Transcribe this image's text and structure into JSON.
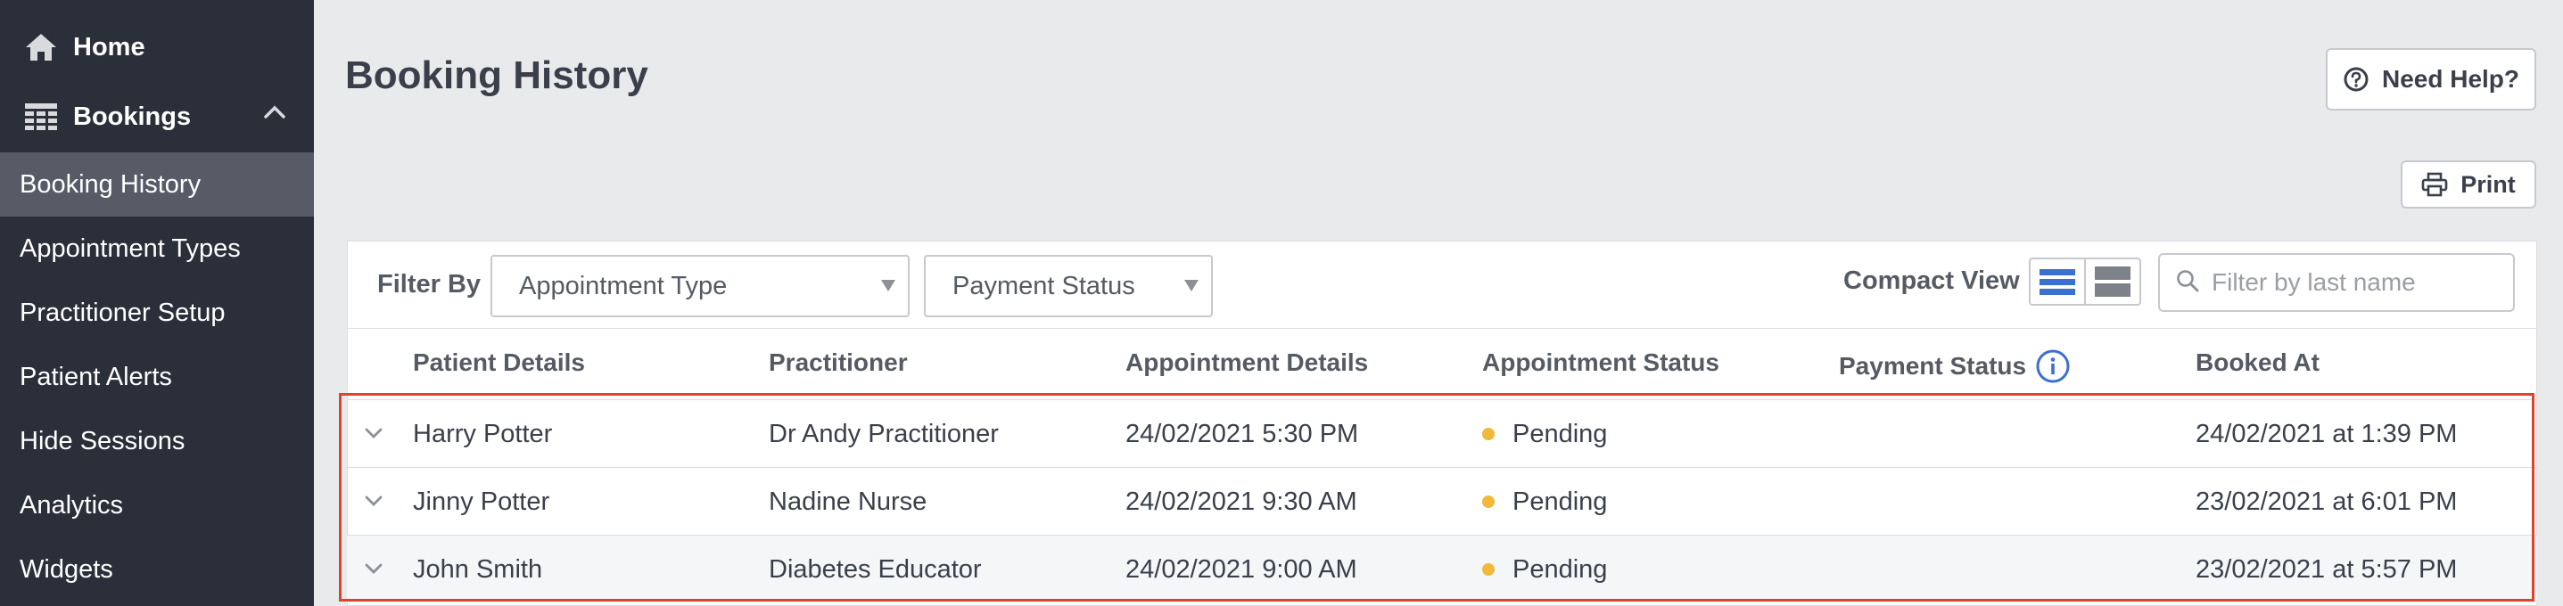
{
  "sidebar": {
    "home": {
      "label": "Home",
      "icon": "home-icon"
    },
    "bookings": {
      "label": "Bookings",
      "icon": "grid-table-icon"
    },
    "items": [
      {
        "label": "Booking History",
        "active": true
      },
      {
        "label": "Appointment Types"
      },
      {
        "label": "Practitioner Setup"
      },
      {
        "label": "Patient Alerts"
      },
      {
        "label": "Hide Sessions"
      },
      {
        "label": "Analytics"
      },
      {
        "label": "Widgets"
      }
    ]
  },
  "header": {
    "title": "Booking History",
    "help_label": "Need Help?",
    "print_label": "Print"
  },
  "filters": {
    "label": "Filter By",
    "appointment_type": "Appointment Type",
    "payment_status": "Payment Status",
    "compact_view_label": "Compact View",
    "search_placeholder": "Filter by last name"
  },
  "table": {
    "columns": [
      "Patient Details",
      "Practitioner",
      "Appointment Details",
      "Appointment Status",
      "Payment Status",
      "Booked At"
    ],
    "rows": [
      {
        "patient": "Harry Potter",
        "practitioner": "Dr Andy Practitioner",
        "appointment": "24/02/2021 5:30 PM",
        "status": "Pending",
        "payment": "",
        "booked": "24/02/2021 at 1:39 PM"
      },
      {
        "patient": "Jinny Potter",
        "practitioner": "Nadine Nurse",
        "appointment": "24/02/2021 9:30 AM",
        "status": "Pending",
        "payment": "",
        "booked": "23/02/2021 at 6:01 PM"
      },
      {
        "patient": "John Smith",
        "practitioner": "Diabetes Educator",
        "appointment": "24/02/2021 9:00 AM",
        "status": "Pending",
        "payment": "",
        "booked": "23/02/2021 at 5:57 PM"
      }
    ]
  },
  "colors": {
    "sidebar_bg": "#2a2f3a",
    "active_item_bg": "#565b66",
    "accent_blue": "#3b6fd0",
    "pending_dot": "#f0b93a",
    "highlight_border": "#e0422e"
  }
}
